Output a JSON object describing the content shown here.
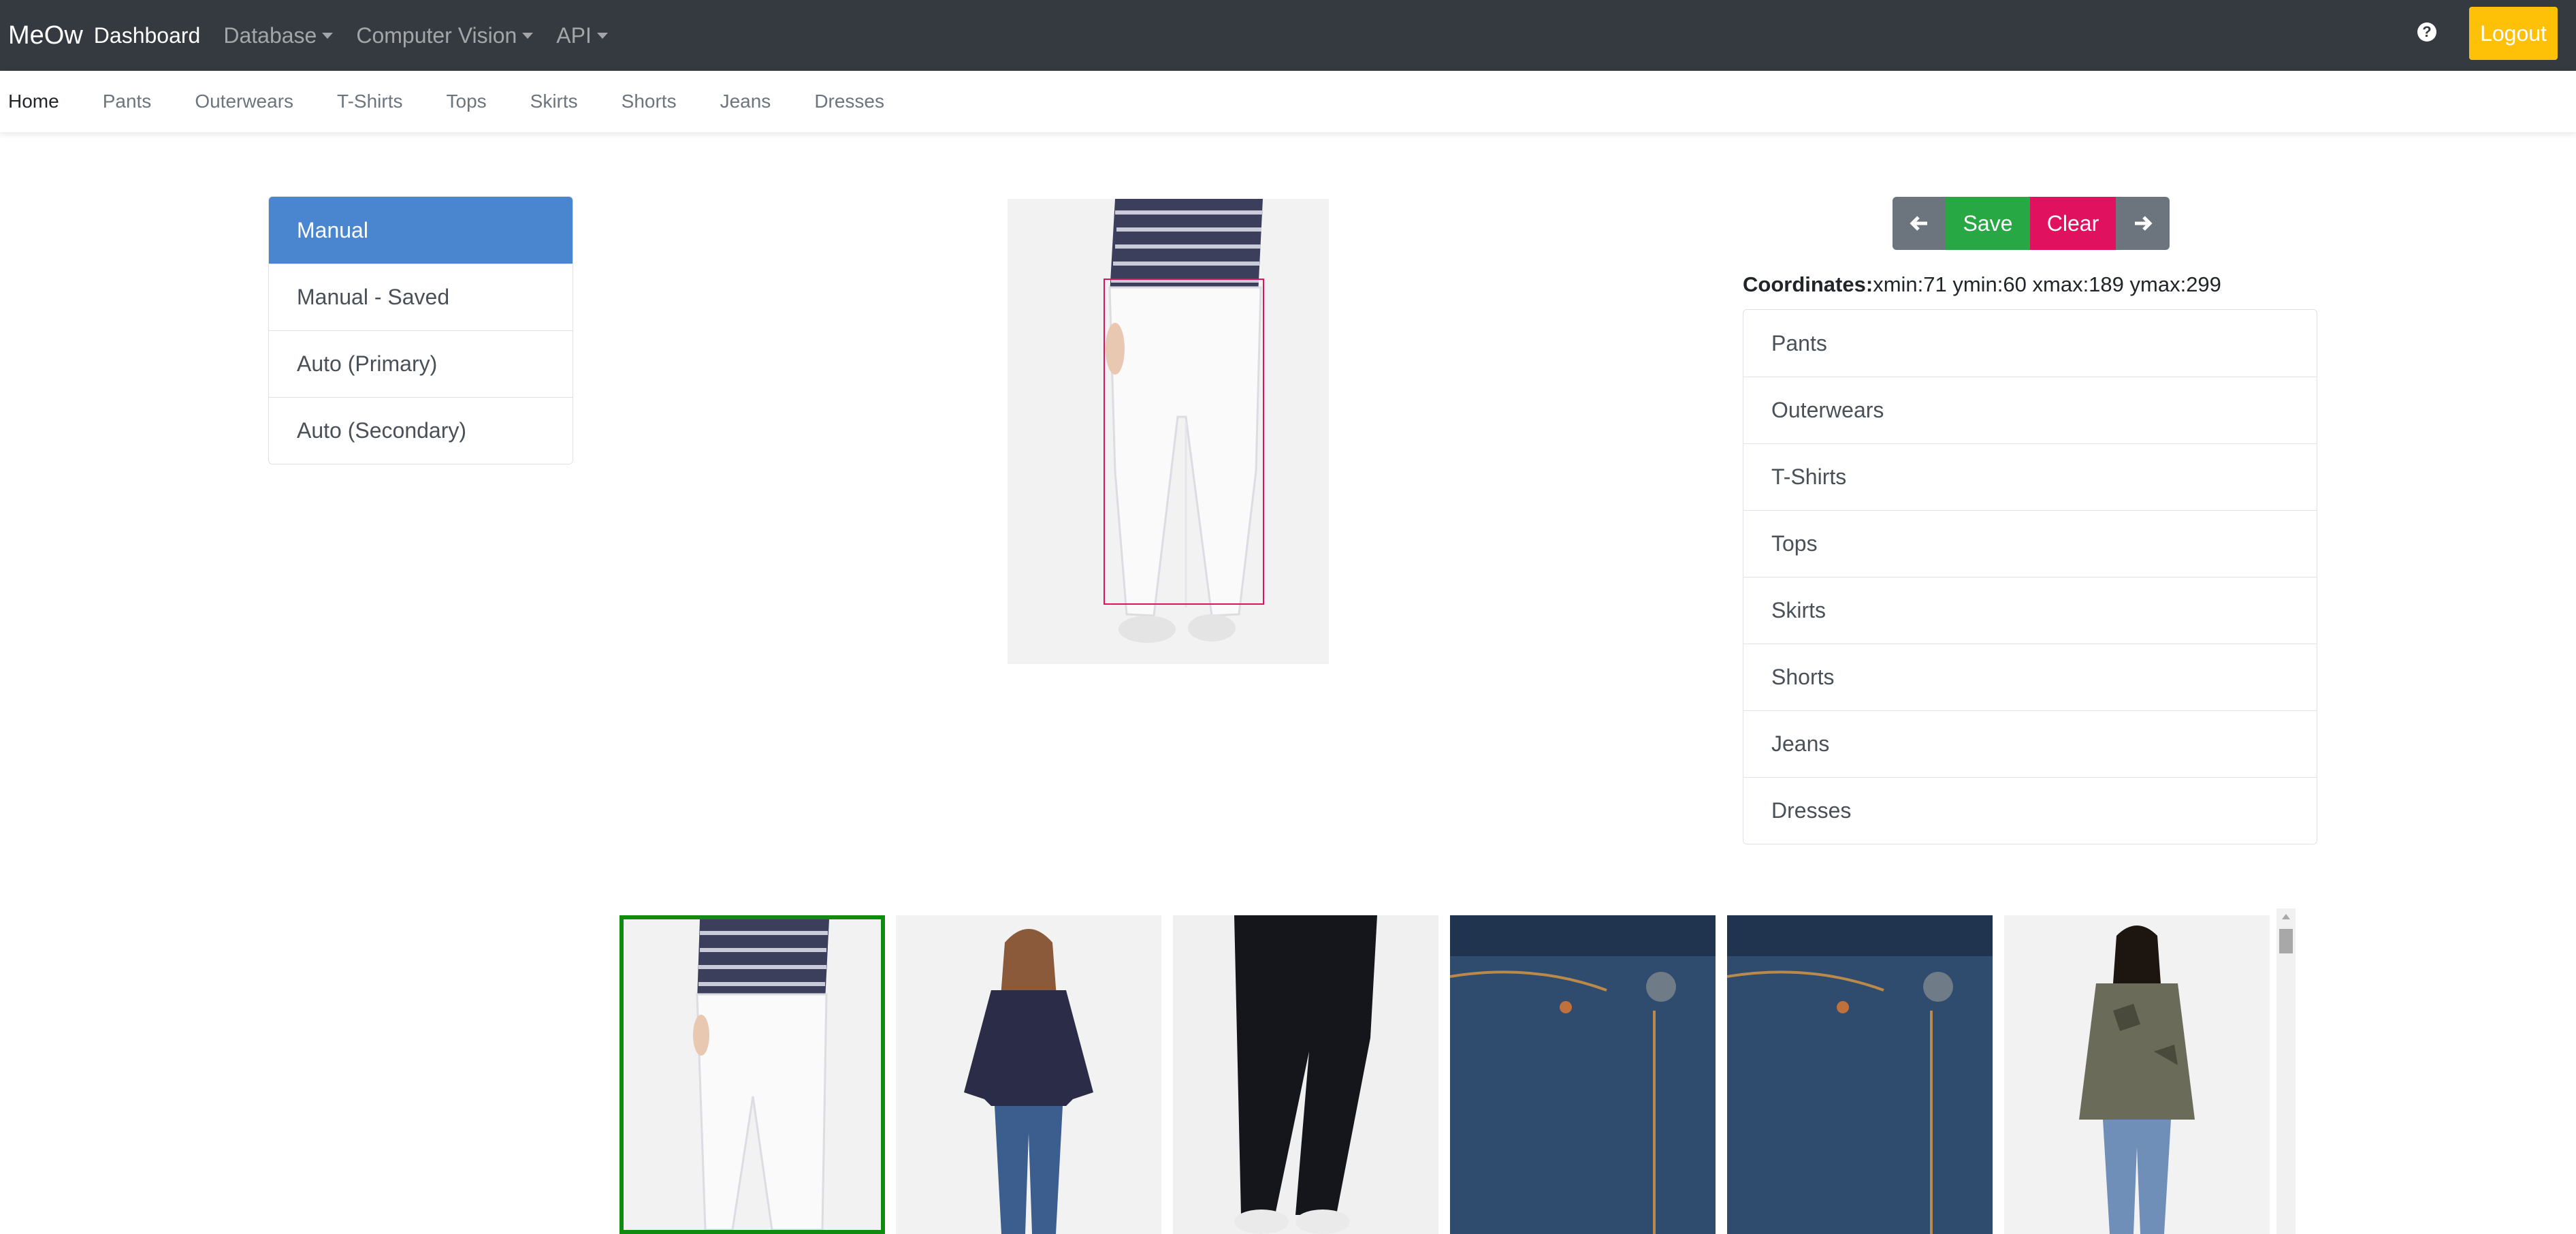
{
  "navbar": {
    "brand": "MeOw",
    "dashboard": "Dashboard",
    "database": "Database",
    "computer_vision": "Computer Vision",
    "api": "API",
    "help_icon": "question-circle-icon",
    "logout": "Logout"
  },
  "subnav": {
    "items": [
      "Home",
      "Pants",
      "Outerwears",
      "T-Shirts",
      "Tops",
      "Skirts",
      "Shorts",
      "Jeans",
      "Dresses"
    ]
  },
  "menu": {
    "items": [
      "Manual",
      "Manual - Saved",
      "Auto (Primary)",
      "Auto (Secondary)"
    ],
    "active": "Manual"
  },
  "toolbar": {
    "prev_icon": "arrow-left-icon",
    "save": "Save",
    "clear": "Clear",
    "next_icon": "arrow-right-icon"
  },
  "coordinates": {
    "label": "Coordinates:",
    "value": "xmin:71 ymin:60 xmax:189 ymax:299"
  },
  "categories": [
    "Pants",
    "Outerwears",
    "T-Shirts",
    "Tops",
    "Skirts",
    "Shorts",
    "Jeans",
    "Dresses"
  ],
  "colors": {
    "navbar": "#343a40",
    "logout": "#ffc107",
    "active_menu": "#4a86cf",
    "save": "#28a745",
    "clear": "#e0115f",
    "selected_thumb": "#118a11"
  }
}
